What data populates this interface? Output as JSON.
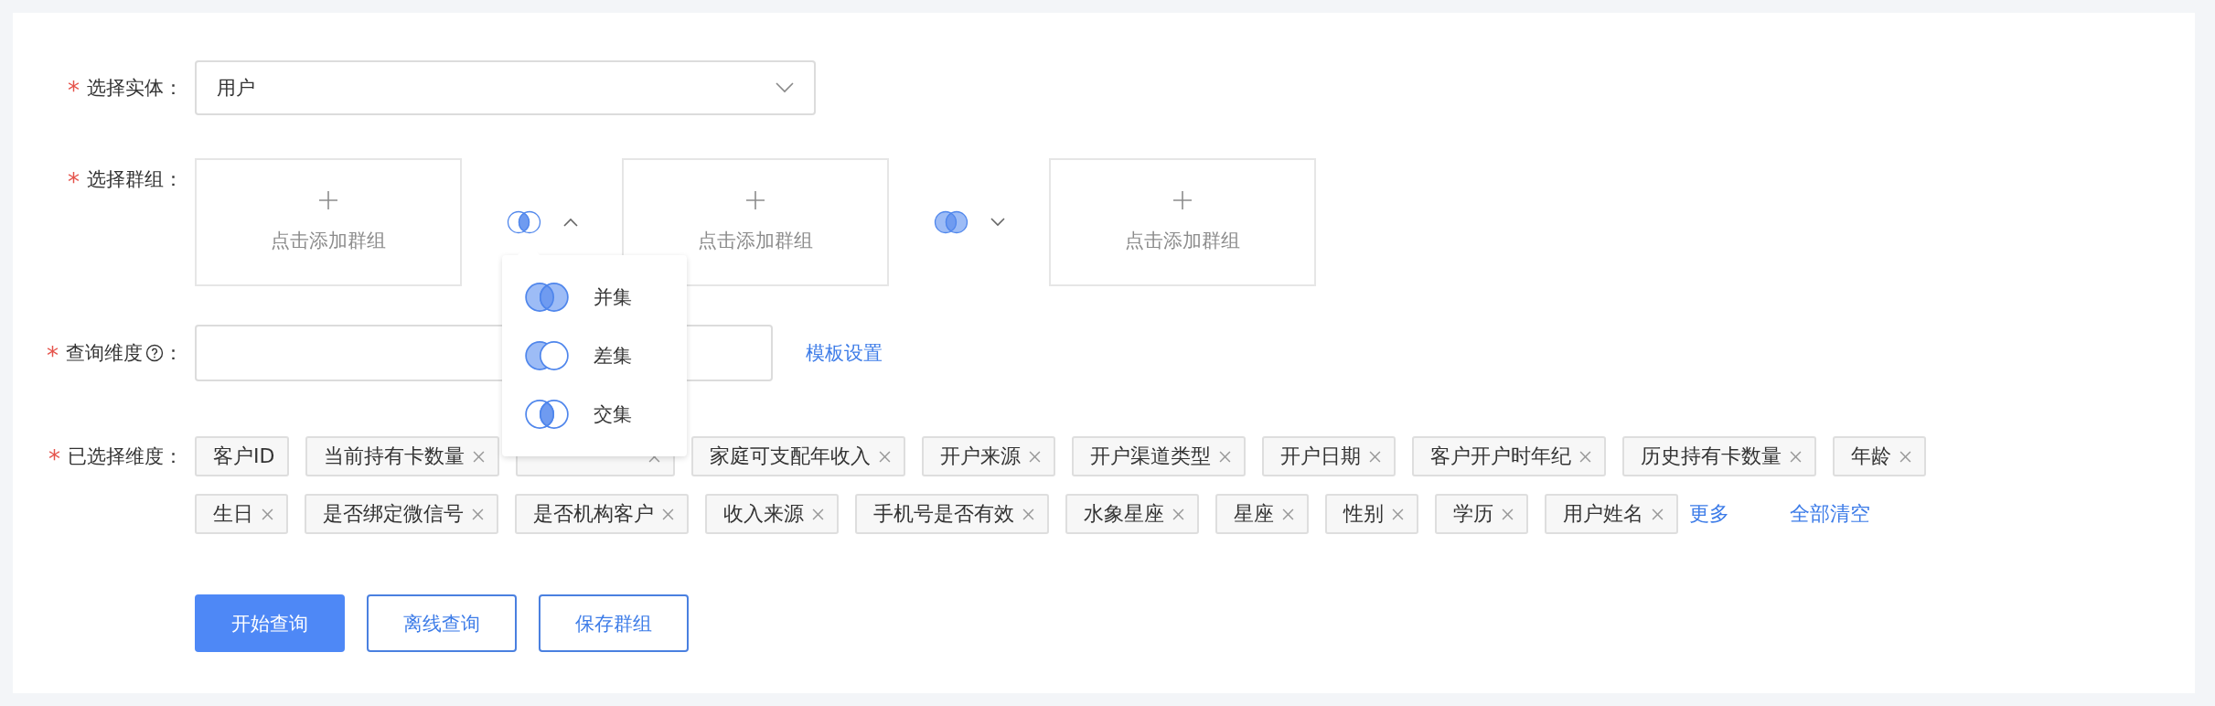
{
  "entity": {
    "required_mark": "*",
    "label": "选择实体：",
    "value": "用户"
  },
  "groups": {
    "required_mark": "*",
    "label": "选择群组：",
    "slots": [
      {
        "text": "点击添加群组"
      },
      {
        "text": "点击添加群组"
      },
      {
        "text": "点击添加群组"
      }
    ],
    "operators": [
      {
        "kind": "intersection",
        "expanded": true
      },
      {
        "kind": "union",
        "expanded": false
      }
    ],
    "menu": [
      {
        "kind": "union",
        "label": "并集",
        "selected": false
      },
      {
        "kind": "difference",
        "label": "差集",
        "selected": false
      },
      {
        "kind": "intersection",
        "label": "交集",
        "selected": false
      }
    ]
  },
  "query_dimension": {
    "required_mark": "*",
    "label": "查询维度",
    "suffix": "：",
    "link": "模板设置"
  },
  "selected_dimensions": {
    "required_mark": "*",
    "label": "已选择维度：",
    "tags": [
      {
        "text": "客户ID",
        "removable": false
      },
      {
        "text": "当前持有卡数量",
        "removable": true
      },
      {
        "removable": true
      },
      {
        "text": "家庭可支配年收入",
        "removable": true
      },
      {
        "text": "开户来源",
        "removable": true
      },
      {
        "text": "开户渠道类型",
        "removable": true
      },
      {
        "text": "开户日期",
        "removable": true
      },
      {
        "text": "客户开户时年纪",
        "removable": true
      },
      {
        "text": "历史持有卡数量",
        "removable": true
      },
      {
        "text": "年龄",
        "removable": true
      },
      {
        "text": "生日",
        "removable": true
      },
      {
        "text": "是否绑定微信号",
        "removable": true
      },
      {
        "text": "是否机构客户",
        "removable": true
      },
      {
        "text": "收入来源",
        "removable": true
      },
      {
        "text": "手机号是否有效",
        "removable": true
      },
      {
        "text": "水象星座",
        "removable": true
      },
      {
        "text": "星座",
        "removable": true
      },
      {
        "text": "性别",
        "removable": true
      },
      {
        "text": "学历",
        "removable": true
      },
      {
        "text": "用户姓名",
        "removable": true
      }
    ],
    "more": "更多",
    "clear": "全部清空"
  },
  "buttons": [
    {
      "kind": "primary",
      "label": "开始查询"
    },
    {
      "kind": "outline",
      "label": "离线查询"
    },
    {
      "kind": "outline",
      "label": "保存群组"
    }
  ]
}
